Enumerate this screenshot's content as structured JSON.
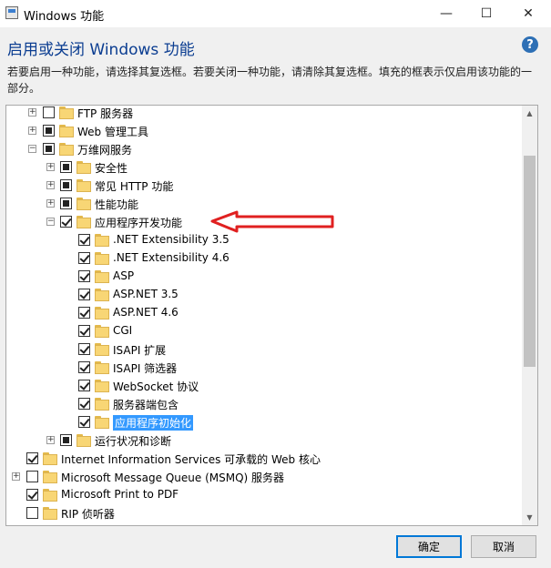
{
  "window": {
    "title": "Windows 功能",
    "minimize_glyph": "—",
    "maximize_glyph": "☐",
    "close_glyph": "✕"
  },
  "header": {
    "title": "启用或关闭 Windows 功能",
    "help_glyph": "?",
    "description": "若要启用一种功能，请选择其复选框。若要关闭一种功能，请清除其复选框。填充的框表示仅启用该功能的一部分。"
  },
  "tree": {
    "items": [
      {
        "label": "FTP 服务器",
        "state": "unchecked",
        "expander": "+"
      },
      {
        "label": "Web 管理工具",
        "state": "partial",
        "expander": "+"
      },
      {
        "label": "万维网服务",
        "state": "partial",
        "expander": "−"
      },
      {
        "label": "安全性",
        "state": "partial",
        "expander": "+"
      },
      {
        "label": "常见 HTTP 功能",
        "state": "partial",
        "expander": "+"
      },
      {
        "label": "性能功能",
        "state": "partial",
        "expander": "+"
      },
      {
        "label": "应用程序开发功能",
        "state": "checked",
        "expander": "−"
      },
      {
        "label": ".NET Extensibility 3.5",
        "state": "checked"
      },
      {
        "label": ".NET Extensibility 4.6",
        "state": "checked"
      },
      {
        "label": "ASP",
        "state": "checked"
      },
      {
        "label": "ASP.NET 3.5",
        "state": "checked"
      },
      {
        "label": "ASP.NET 4.6",
        "state": "checked"
      },
      {
        "label": "CGI",
        "state": "checked"
      },
      {
        "label": "ISAPI 扩展",
        "state": "checked"
      },
      {
        "label": "ISAPI 筛选器",
        "state": "checked"
      },
      {
        "label": "WebSocket 协议",
        "state": "checked"
      },
      {
        "label": "服务器端包含",
        "state": "checked"
      },
      {
        "label": "应用程序初始化",
        "state": "checked",
        "selected": true
      },
      {
        "label": "运行状况和诊断",
        "state": "partial",
        "expander": "+"
      },
      {
        "label": "Internet Information Services 可承载的 Web 核心",
        "state": "checked"
      },
      {
        "label": "Microsoft Message Queue (MSMQ) 服务器",
        "state": "unchecked",
        "expander": "+"
      },
      {
        "label": "Microsoft Print to PDF",
        "state": "checked"
      },
      {
        "label": "RIP 侦听器",
        "state": "unchecked"
      }
    ]
  },
  "annotation": {
    "color": "#e02020",
    "icon": "red-arrow-left"
  },
  "buttons": {
    "ok": "确定",
    "cancel": "取消"
  },
  "colors": {
    "selection": "#3399ff",
    "title_text": "#0b3d91",
    "primary_border": "#0078d7"
  }
}
